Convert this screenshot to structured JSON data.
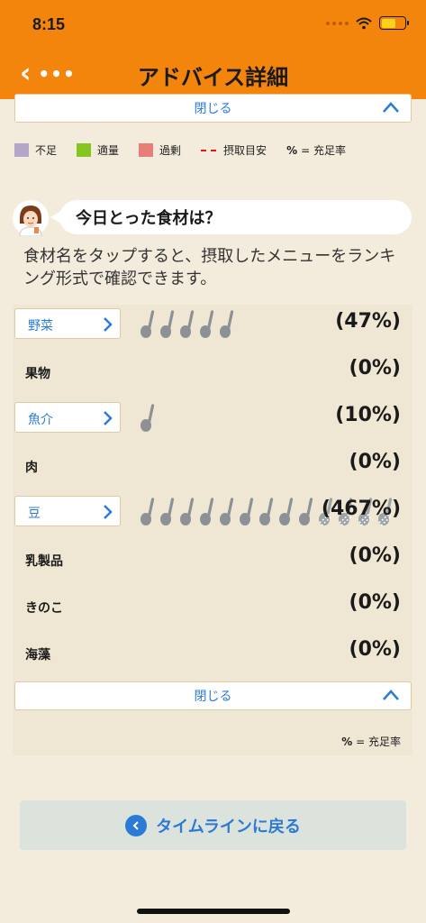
{
  "status_bar": {
    "time": "8:15"
  },
  "nav": {
    "title": "アドバイス詳細",
    "back_more": "•••"
  },
  "close_label": "閉じる",
  "legend": {
    "items": [
      {
        "label": "不足",
        "color": "#b3a6c8"
      },
      {
        "label": "適量",
        "color": "#84c51f"
      },
      {
        "label": "過剰",
        "color": "#e77f78"
      }
    ],
    "target_label": "摂取目安",
    "pct_symbol": "%",
    "pct_label": "= 充足率"
  },
  "question": {
    "title": "今日とった食材は？",
    "description": "食材名をタップすると、摂取したメニューをランキング形式で確認できます。"
  },
  "foods": [
    {
      "name": "野菜",
      "tappable": true,
      "percent": "(47%)",
      "spoons": 5,
      "faded_spoons": 0
    },
    {
      "name": "果物",
      "tappable": false,
      "percent": "(0%)",
      "spoons": 0,
      "faded_spoons": 0
    },
    {
      "name": "魚介",
      "tappable": true,
      "percent": "(10%)",
      "spoons": 1,
      "faded_spoons": 0
    },
    {
      "name": "肉",
      "tappable": false,
      "percent": "(0%)",
      "spoons": 0,
      "faded_spoons": 0
    },
    {
      "name": "豆",
      "tappable": true,
      "percent": "(467%)",
      "spoons": 9,
      "faded_spoons": 4
    },
    {
      "name": "乳製品",
      "tappable": false,
      "percent": "(0%)",
      "spoons": 0,
      "faded_spoons": 0
    },
    {
      "name": "きのこ",
      "tappable": false,
      "percent": "(0%)",
      "spoons": 0,
      "faded_spoons": 0
    },
    {
      "name": "海藻",
      "tappable": false,
      "percent": "(0%)",
      "spoons": 0,
      "faded_spoons": 0
    }
  ],
  "footer": {
    "pct_symbol": "%",
    "pct_label": "= 充足率",
    "timeline_button": "タイムラインに戻る"
  }
}
